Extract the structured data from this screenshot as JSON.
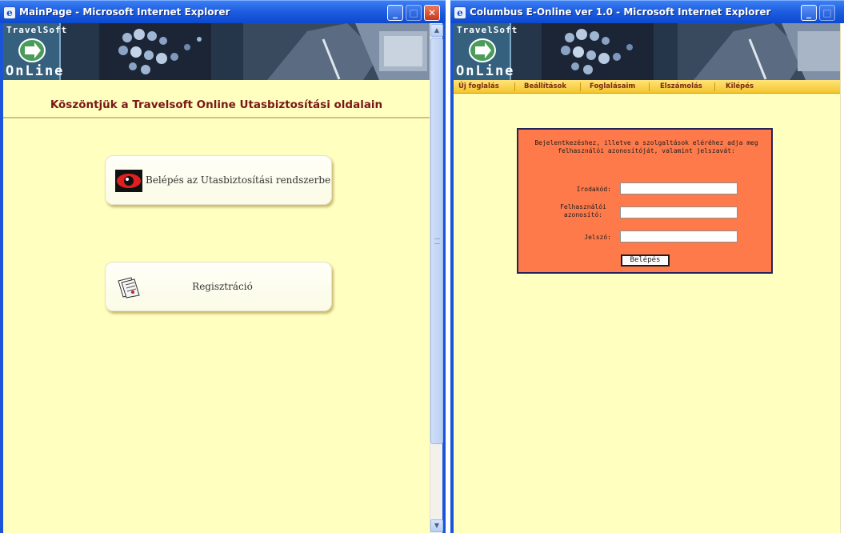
{
  "left_window": {
    "title": "MainPage - Microsoft Internet Explorer",
    "logo": {
      "top": "TravelSoft",
      "bottom": "OnLine"
    },
    "welcome": "Köszöntjük a Travelsoft Online Utasbiztosítási oldalain",
    "buttons": [
      {
        "label": "Belépés az Utasbiztosítási rendszerbe",
        "icon": "eye-icon"
      },
      {
        "label": "Regisztráció",
        "icon": "documents-icon"
      }
    ],
    "scrollbar": {
      "up": "▲",
      "down": "▼"
    }
  },
  "right_window": {
    "title": "Columbus E-Online ver 1.0 - Microsoft Internet Explorer",
    "logo": {
      "top": "TravelSoft",
      "bottom": "OnLine"
    },
    "menu": [
      "Új foglalás",
      "Beállítások",
      "Foglalásaim",
      "Elszámolás",
      "Kilépés"
    ],
    "login": {
      "message": "Bejelentkezéshez, illetve a szolgaltások eléréhez adja meg felhasználói azonosítóját, valamint jelszavát:",
      "fields": [
        {
          "label": "Irodakód:",
          "value": ""
        },
        {
          "label": "Felhasználói azonosító:",
          "value": ""
        },
        {
          "label": "Jelszó:",
          "value": ""
        }
      ],
      "submit": "Belépés"
    }
  },
  "window_controls": {
    "minimize": "_",
    "maximize": "□",
    "close": "✕"
  },
  "colors": {
    "page_background": "#ffffc0",
    "titlebar": "#1f5fe0",
    "welcome_text": "#7a1717",
    "menu_bar": "#f5c52d",
    "menu_text": "#7a2a12",
    "login_box": "#ff7a4a"
  }
}
